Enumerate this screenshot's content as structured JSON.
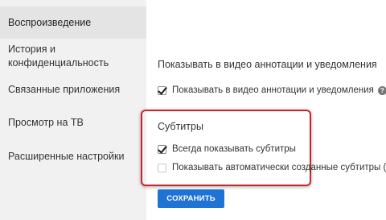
{
  "sidebar": {
    "items": [
      {
        "label": "Воспроизведение",
        "active": true
      },
      {
        "label_line1": "История и",
        "label_line2": "конфиденциальность",
        "active": false
      },
      {
        "label": "Связанные приложения",
        "active": false
      },
      {
        "label": "Просмотр на ТВ",
        "active": false
      },
      {
        "label": "Расширенные настройки",
        "active": false
      }
    ]
  },
  "annotations": {
    "heading": "Показывать в видео аннотации и уведомления",
    "checkbox_label": "Показывать в видео аннотации и уведомления",
    "checkbox_checked": true,
    "help_icon": "question-circle-icon"
  },
  "subtitles": {
    "heading": "Субтитры",
    "always_show_label": "Всегда показывать субтитры",
    "always_show_checked": true,
    "auto_generated_label": "Показывать автоматически созданные субтитры (есл",
    "auto_generated_checked": false
  },
  "actions": {
    "save_label": "СОХРАНИТЬ"
  },
  "colors": {
    "sidebar_bg": "#f1f1f1",
    "active_item_bg": "#e4e4e4",
    "highlight_border": "#c7262b",
    "button_bg": "#1e73d4"
  }
}
